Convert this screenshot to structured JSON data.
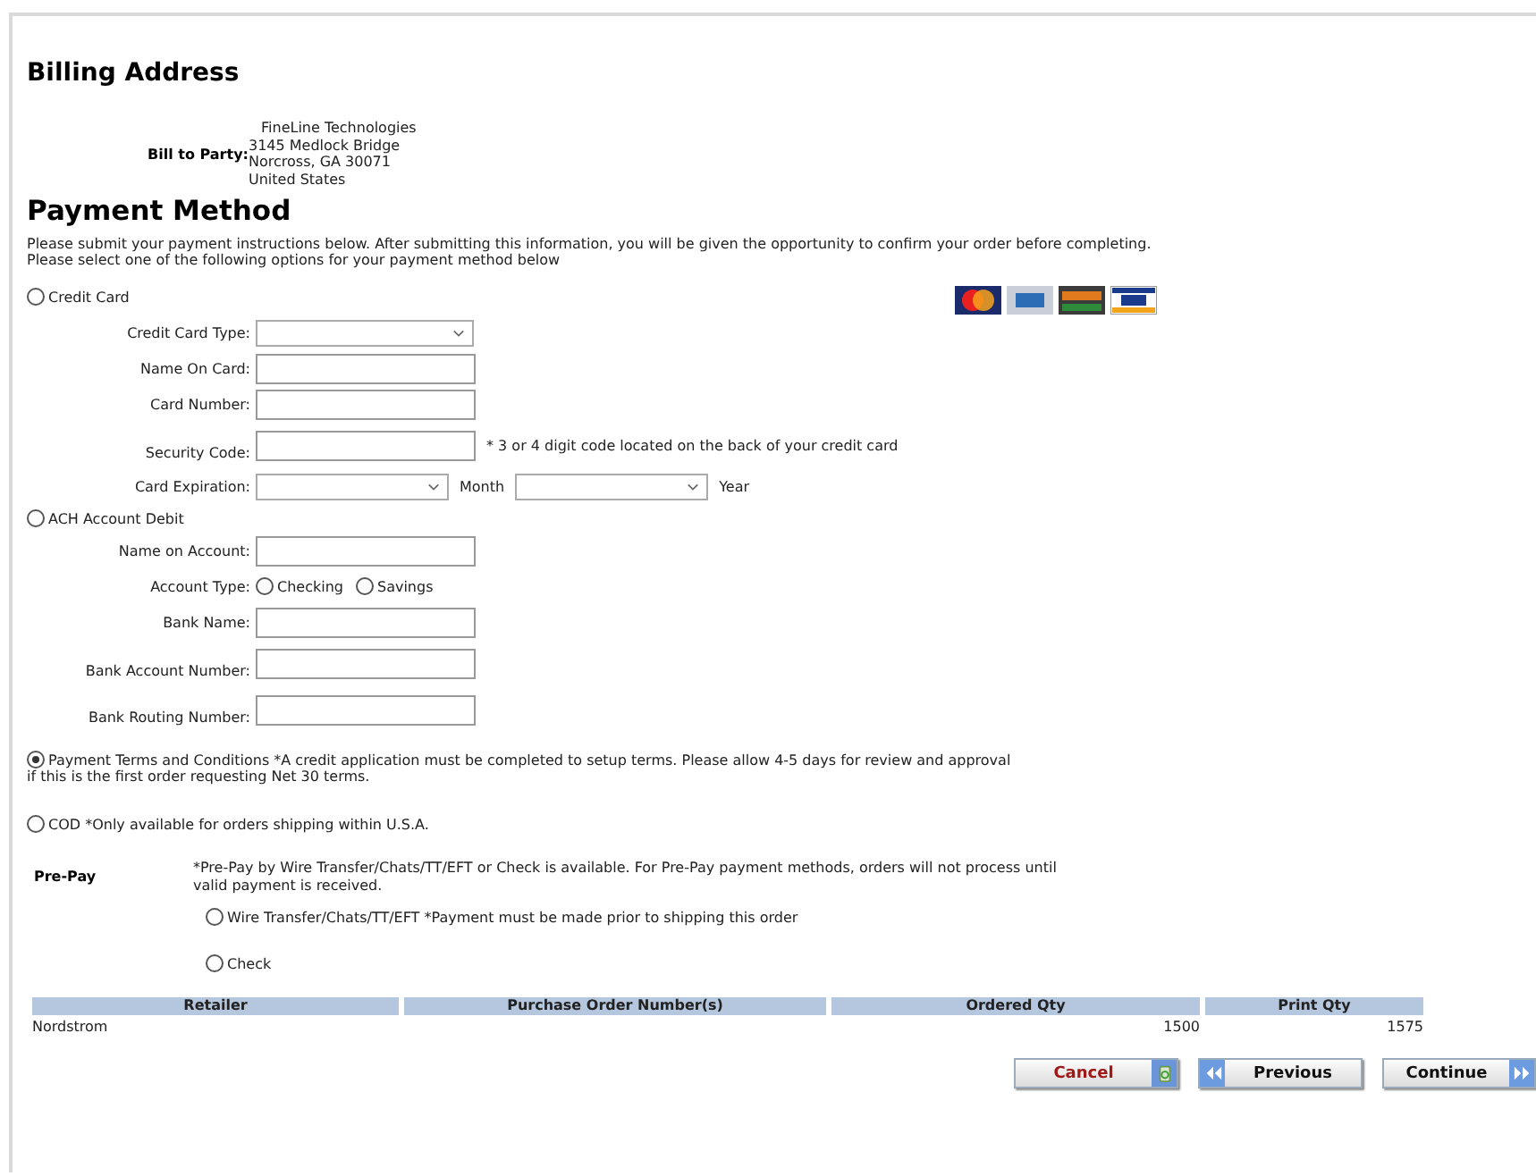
{
  "billing": {
    "heading": "Billing Address",
    "label": "Bill to Party:",
    "address": [
      "FineLine Technologies",
      "3145 Medlock Bridge",
      "Norcross, GA 30071",
      "United States"
    ]
  },
  "payment": {
    "heading": "Payment Method",
    "instructions": [
      "Please submit your payment instructions below. After submitting this information, you will be given the opportunity to confirm your order before completing.",
      "Please select one of the following options for your payment method below"
    ]
  },
  "credit_card": {
    "label": "Credit Card",
    "selected": false,
    "fields": [
      {
        "kind": "select",
        "label": "Credit Card Type:"
      },
      {
        "kind": "input",
        "label": "Name On Card:"
      },
      {
        "kind": "input",
        "label": "Card Number:"
      },
      {
        "kind": "input",
        "label": "Security Code:",
        "note": "* 3 or 4 digit code located on the back of your credit card"
      },
      {
        "kind": "expiry",
        "label": "Card Expiration:",
        "month": "Month",
        "year": "Year"
      }
    ]
  },
  "ach": {
    "label": "ACH Account Debit",
    "selected": false,
    "fields": [
      {
        "kind": "input",
        "label": "Name on Account:"
      },
      {
        "kind": "radios",
        "label": "Account Type:",
        "options": [
          {
            "label": "Checking",
            "selected": false
          },
          {
            "label": "Savings",
            "selected": false
          }
        ]
      },
      {
        "kind": "input",
        "label": "Bank Name:"
      },
      {
        "kind": "input",
        "label": "Bank Account Number:"
      },
      {
        "kind": "input",
        "label": "Bank Routing Number:"
      }
    ]
  },
  "terms": {
    "label": "Payment Terms and Conditions *A credit application must be completed to setup terms. Please allow 4-5 days for review and approval",
    "continuation": "if this is the first order requesting Net 30 terms.",
    "selected": true
  },
  "cod": {
    "label": "COD *Only available for orders shipping within U.S.A.",
    "selected": false
  },
  "prepay": {
    "heading": "Pre-Pay",
    "note": "*Pre-Pay by Wire Transfer/Chats/TT/EFT or Check is available. For Pre-Pay payment methods, orders will not process until valid payment is received.",
    "options": [
      {
        "label": "Wire Transfer/Chats/TT/EFT *Payment must be made prior to shipping this order",
        "selected": false
      },
      {
        "label": "Check",
        "selected": false
      }
    ]
  },
  "table": {
    "columns": [
      "Retailer",
      "Purchase Order Number(s)",
      "Ordered Qty",
      "Print Qty"
    ],
    "rows": [
      {
        "retailer": "Nordstrom",
        "ordered_qty": "1500",
        "print_qty": "1575"
      }
    ]
  },
  "buttons": [
    {
      "kind": "cancel",
      "label": "Cancel"
    },
    {
      "kind": "previous",
      "label": "Previous"
    },
    {
      "kind": "continue",
      "label": "Continue"
    }
  ]
}
